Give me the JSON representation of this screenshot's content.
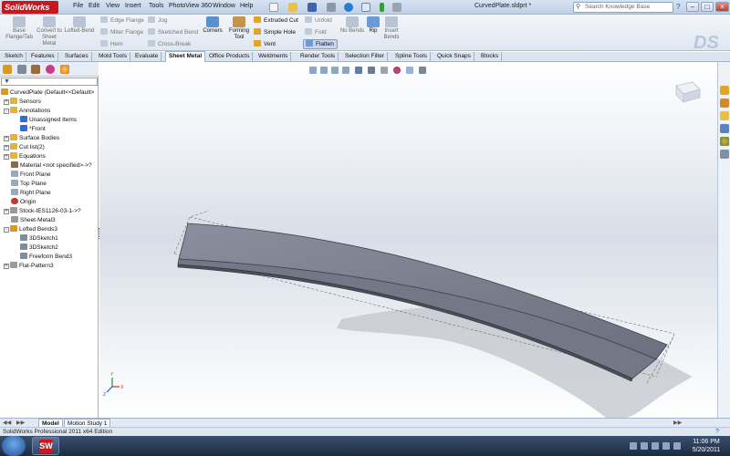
{
  "app": {
    "logo_text": "SolidWorks",
    "document_title": "CurvedPlate.sldprt *",
    "menu": [
      "File",
      "Edit",
      "View",
      "Insert",
      "Tools",
      "PhotoView 360",
      "Window",
      "Help"
    ],
    "search_placeholder": "Search Knowledge Base"
  },
  "ribbon": {
    "base_flange": "Base Flange/Tab",
    "convert": "Convert to Sheet Metal",
    "lofted_bend": "Lofted-Bend",
    "edge_flange": "Edge Flange",
    "miter_flange": "Miter Flange",
    "hem": "Hem",
    "jog": "Jog",
    "sketched_bend": "Sketched Bend",
    "cross_break": "Cross-Break",
    "corners": "Corners",
    "forming_tool": "Forming Tool",
    "extruded_cut": "Extruded Cut",
    "simple_hole": "Simple Hole",
    "vent": "Vent",
    "unfold": "Unfold",
    "fold": "Fold",
    "flatten": "Flatten",
    "no_bends": "No Bends",
    "rip": "Rip",
    "insert_bends": "Insert Bends"
  },
  "tabs": [
    "Sketch",
    "Features",
    "Surfaces",
    "Mold Tools",
    "Evaluate",
    "Sheet Metal",
    "Office Products",
    "Weldments",
    "Render Tools",
    "Selection Filter",
    "Spline Tools",
    "Quick Snaps",
    "Blocks"
  ],
  "active_tab": "Sheet Metal",
  "tree": [
    {
      "label": "CurvedPlate  (Default<<Default>",
      "icon_color": "#d99a1e"
    },
    {
      "label": "Sensors",
      "icon_color": "#e0b33c"
    },
    {
      "label": "Annotations",
      "icon_color": "#e0b33c"
    },
    {
      "label": "Unassigned Items",
      "icon_color": "#2f6fd1"
    },
    {
      "label": "*Front",
      "icon_color": "#2f6fd1"
    },
    {
      "label": "Surface Bodies",
      "icon_color": "#e0b33c"
    },
    {
      "label": "Cut list(2)",
      "icon_color": "#e0b33c"
    },
    {
      "label": "Equations",
      "icon_color": "#e0b33c"
    },
    {
      "label": "Material <not specified>->?",
      "icon_color": "#8a6d3b"
    },
    {
      "label": "Front Plane",
      "icon_color": "#9aa9bd"
    },
    {
      "label": "Top Plane",
      "icon_color": "#9aa9bd"
    },
    {
      "label": "Right Plane",
      "icon_color": "#9aa9bd"
    },
    {
      "label": "Origin",
      "icon_color": "#c0392b"
    },
    {
      "label": "Stock-IES1126-03-1->?",
      "icon_color": "#9a9a9a"
    },
    {
      "label": "Sheet-Metal3",
      "icon_color": "#9a9a9a"
    },
    {
      "label": "Lofted Bends3",
      "icon_color": "#d99a1e"
    },
    {
      "label": "3DSketch1",
      "icon_color": "#7f8c9d"
    },
    {
      "label": "3DSketch2",
      "icon_color": "#7f8c9d"
    },
    {
      "label": "Freeform Bend3",
      "icon_color": "#7f8c9d"
    },
    {
      "label": "Flat-Pattern3",
      "icon_color": "#9a9a9a"
    }
  ],
  "bottom_tabs": [
    "Model",
    "Motion Study 1"
  ],
  "status": "SolidWorks Professional 2011 x64 Edition",
  "taskbar": {
    "time": "11:06 PM",
    "date": "5/20/2011",
    "app_icon_text": "SW"
  },
  "colors": {
    "brand_red": "#c9171d",
    "accent_blue": "#1b56b3",
    "part_face": "#7a7f8d"
  }
}
